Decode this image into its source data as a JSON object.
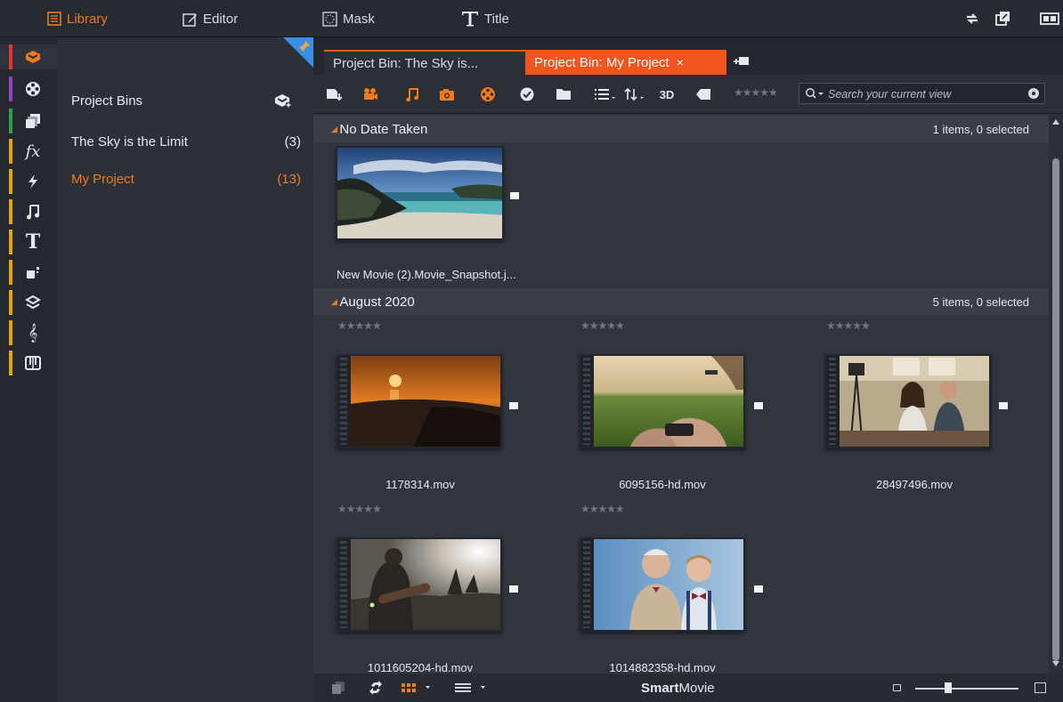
{
  "top_menu": {
    "library": "Library",
    "editor": "Editor",
    "mask": "Mask",
    "title": "Title"
  },
  "bins": {
    "heading": "Project Bins",
    "items": [
      {
        "label": "The Sky is the Limit",
        "count": "(3)"
      },
      {
        "label": "My Project",
        "count": "(13)"
      }
    ]
  },
  "tabs": [
    {
      "label": "Project Bin: The Sky is..."
    },
    {
      "label": "Project Bin: My Project",
      "close": "×"
    }
  ],
  "toolbar": {
    "view_3d": "3D",
    "rating_stars": "★★★★★",
    "search_placeholder": "Search your current view"
  },
  "groups": [
    {
      "title": "No Date Taken",
      "count": "1 items, 0 selected",
      "items": [
        {
          "name": "New Movie (2).Movie_Snapshot.j...",
          "type": "image"
        }
      ]
    },
    {
      "title": "August 2020",
      "count": "5 items, 0 selected",
      "items": [
        {
          "name": "1178314.mov",
          "type": "video",
          "stars": "★★★★★"
        },
        {
          "name": "6095156-hd.mov",
          "type": "video",
          "stars": "★★★★★"
        },
        {
          "name": "28497496.mov",
          "type": "video",
          "stars": "★★★★★"
        },
        {
          "name": "1011605204-hd.mov",
          "type": "video",
          "stars": "★★★★★"
        },
        {
          "name": "1014882358-hd.mov",
          "type": "video",
          "stars": "★★★★★"
        }
      ]
    }
  ],
  "bottom": {
    "smartmovie_bold": "Smart",
    "smartmovie_rest": "Movie",
    "zoom_fraction": 0.32
  },
  "colors": {
    "accent_orange": "#f27a1a",
    "active_tab": "#f0541f",
    "pin_blue": "#3a8ee6"
  }
}
